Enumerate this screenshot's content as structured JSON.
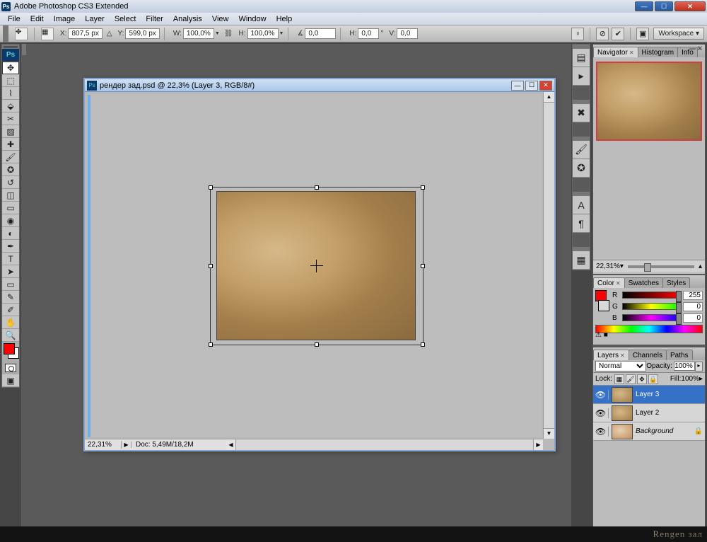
{
  "app": {
    "title": "Adobe Photoshop CS3 Extended",
    "icon": "Ps"
  },
  "menu": [
    "File",
    "Edit",
    "Image",
    "Layer",
    "Select",
    "Filter",
    "Analysis",
    "View",
    "Window",
    "Help"
  ],
  "options": {
    "x": "807,5 px",
    "y": "599,0 px",
    "w": "100,0%",
    "h": "100,0%",
    "angle": "0,0",
    "hskew": "0,0",
    "vskew": "0,0",
    "workspace": "Workspace"
  },
  "document": {
    "title": "рендер зад.psd @ 22,3% (Layer 3, RGB/8#)",
    "zoom": "22,31%",
    "info": "Doc: 5,49M/18,2M"
  },
  "navigator": {
    "tabs": [
      "Navigator",
      "Histogram",
      "Info"
    ],
    "zoom": "22,31%"
  },
  "color": {
    "tabs": [
      "Color",
      "Swatches",
      "Styles"
    ],
    "r": "255",
    "g": "0",
    "b": "0",
    "foreground": "#ff0000"
  },
  "layers": {
    "tabs": [
      "Layers",
      "Channels",
      "Paths"
    ],
    "blend_mode": "Normal",
    "opacity_label": "Opacity:",
    "opacity": "100%",
    "lock_label": "Lock:",
    "fill_label": "Fill:",
    "fill": "100%",
    "items": [
      {
        "name": "Layer 3",
        "selected": true,
        "locked": false
      },
      {
        "name": "Layer 2",
        "selected": false,
        "locked": false
      },
      {
        "name": "Background",
        "selected": false,
        "locked": true
      }
    ]
  },
  "footer": {
    "watermark": "Rengen зал"
  }
}
